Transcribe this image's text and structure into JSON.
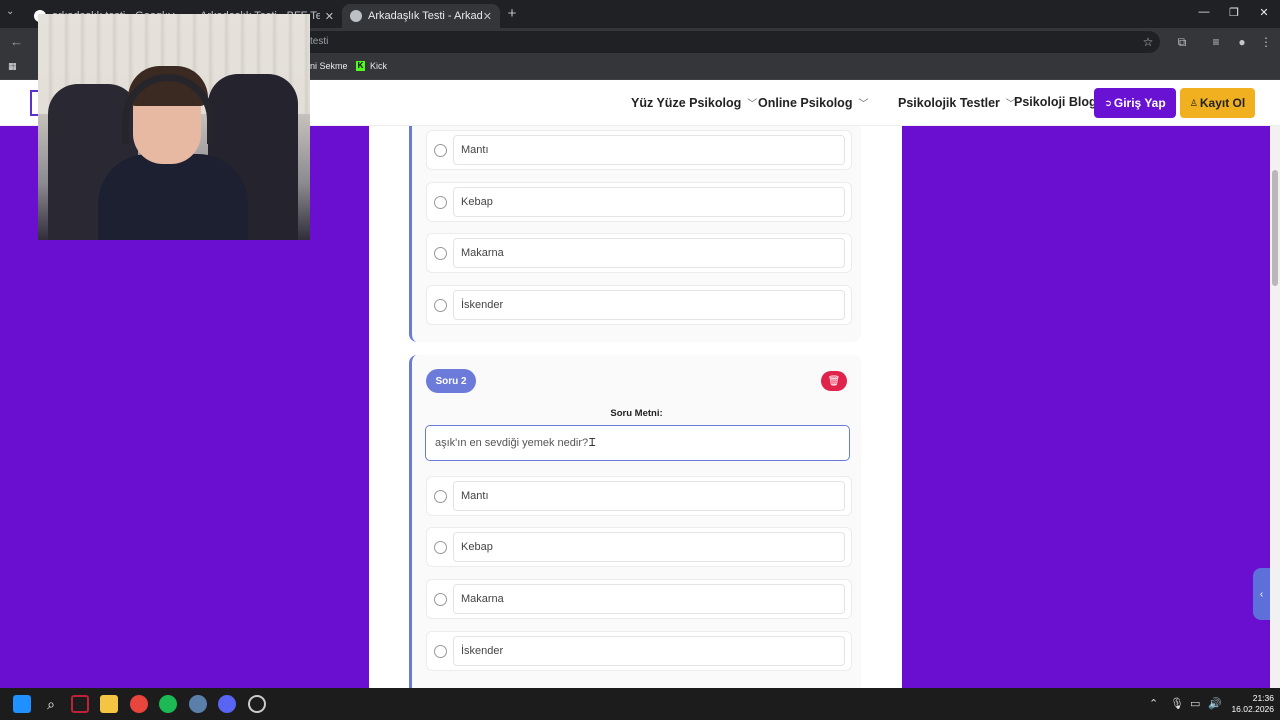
{
  "browser": {
    "tabs": [
      {
        "title": "arkadaşlık testi - Google'da Ara",
        "active": false
      },
      {
        "title": "Arkadaşlık Testi - BFF Testi - En...",
        "active": false
      },
      {
        "title": "Arkadaşlık Testi - Arkadaşlarını...",
        "active": true
      }
    ],
    "address": "testi",
    "bookmarks": [
      {
        "label": "ni Sekme"
      },
      {
        "label": "Kick"
      }
    ]
  },
  "header": {
    "nav": [
      {
        "label": "Yüz Yüze Psikolog",
        "dropdown": true
      },
      {
        "label": "Online Psikolog",
        "dropdown": true
      },
      {
        "label": "Psikolojik Testler",
        "dropdown": true
      },
      {
        "label": "Psikoloji Blog",
        "dropdown": false
      }
    ],
    "login_label": "Giriş Yap",
    "signup_label": "Kayıt Ol"
  },
  "questions": [
    {
      "options": [
        "Mantı",
        "Kebap",
        "Makarna",
        "İskender"
      ]
    },
    {
      "badge": "Soru 2",
      "label": "Soru Metni:",
      "text": "aşık'ın en sevdiği yemek nedir?",
      "options": [
        "Mantı",
        "Kebap",
        "Makarna",
        "İskender"
      ]
    }
  ],
  "taskbar": {
    "time": "21:36",
    "date": "16.02.2026"
  },
  "colors": {
    "page_bg": "#6a0ecf",
    "accent": "#6c7bd9",
    "login": "#6a12d4",
    "signup": "#f0b020",
    "delete": "#e0234a"
  }
}
